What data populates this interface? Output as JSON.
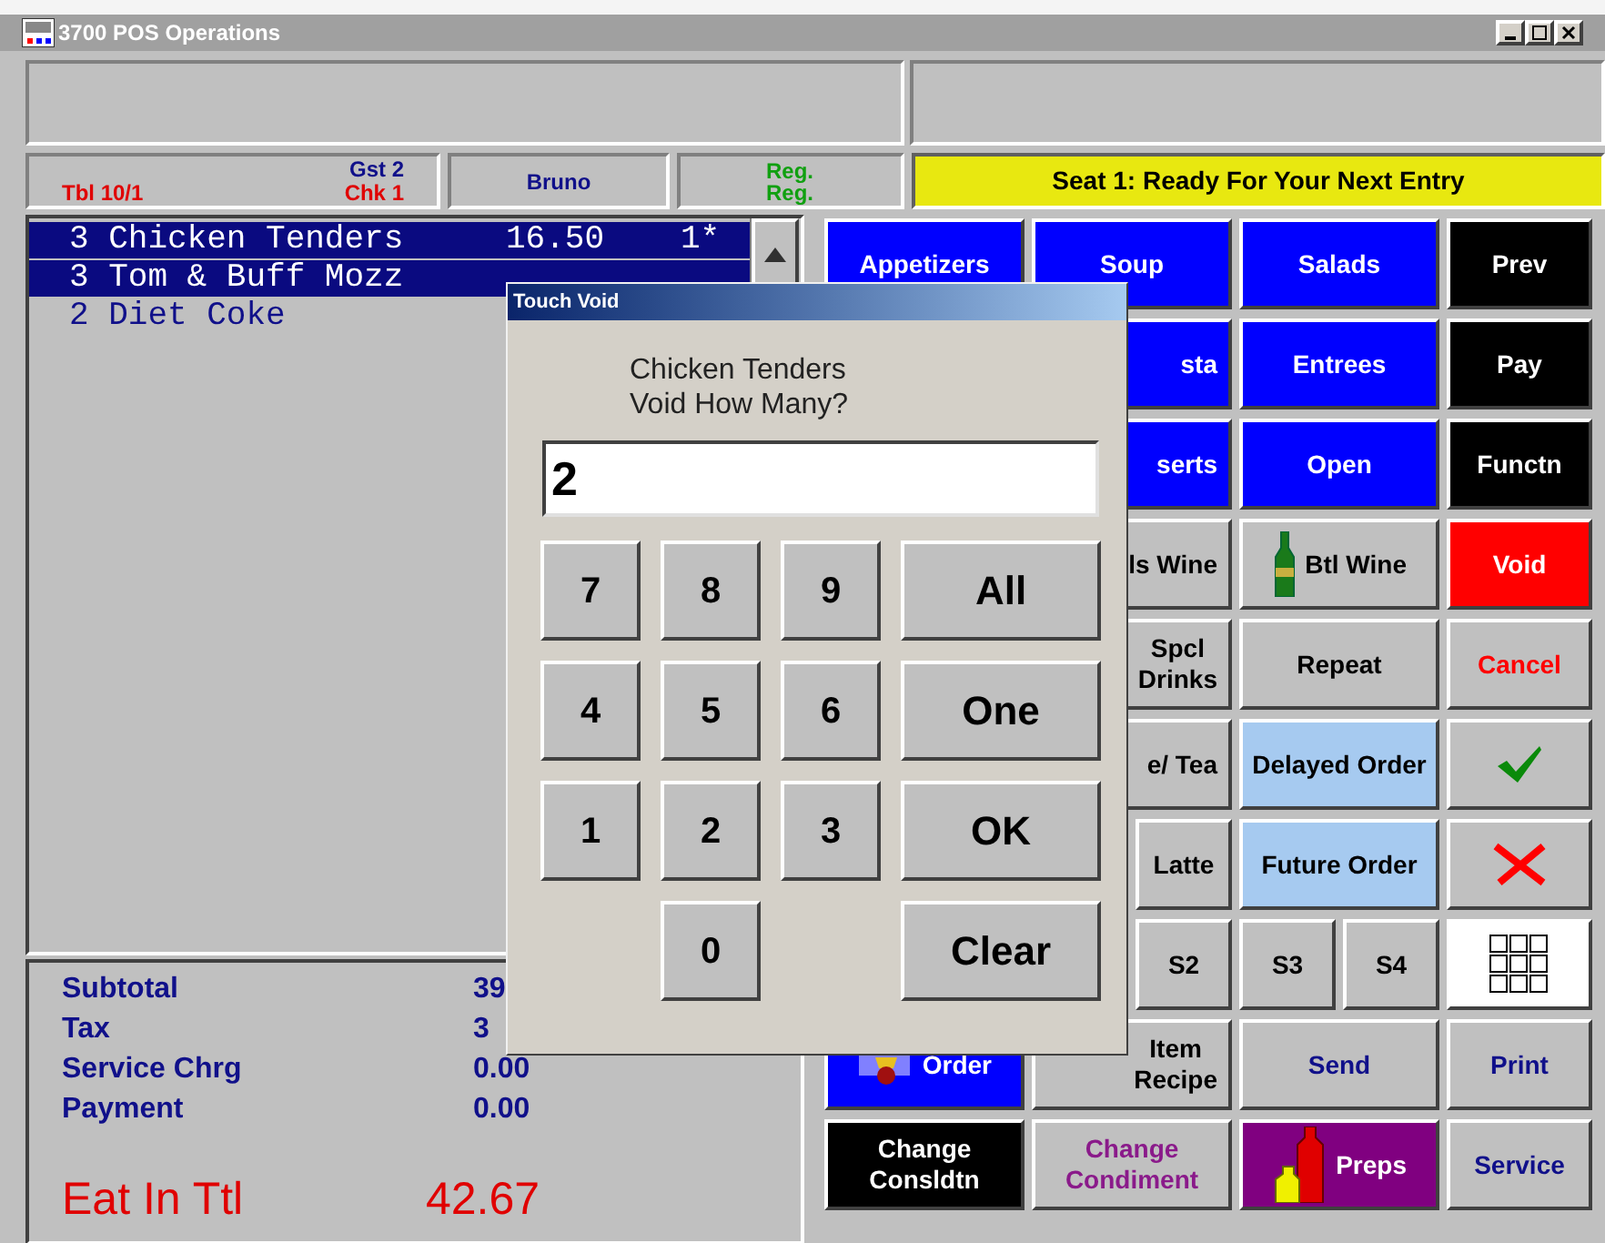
{
  "window": {
    "title": "3700 POS Operations"
  },
  "header": {
    "table": "Tbl 10/1",
    "guests": "Gst 2",
    "check": "Chk 1",
    "employee": "Bruno",
    "modes": [
      "Reg.",
      "Reg."
    ],
    "status": "Seat 1: Ready For Your Next Entry"
  },
  "check_items": [
    {
      "text": "3 Chicken Tenders",
      "price": "16.50",
      "seat": "1*",
      "selected": true
    },
    {
      "text": "3 Tom & Buff Mozz",
      "selected": true
    },
    {
      "text": "2 Diet Coke",
      "selected": false
    }
  ],
  "totals": [
    {
      "label": "Subtotal",
      "value": "39"
    },
    {
      "label": "Tax",
      "value": "3"
    },
    {
      "label": "Service Chrg",
      "value": "0.00"
    },
    {
      "label": "Payment",
      "value": "0.00"
    }
  ],
  "grand_total": {
    "label": "Eat In Ttl",
    "value": "42.67"
  },
  "keys": [
    {
      "kind": "menu",
      "label": "Appetizers"
    },
    {
      "kind": "menu",
      "label": "Soup"
    },
    {
      "kind": "menu",
      "label": "Salads"
    },
    {
      "kind": "command",
      "label": "Prev"
    },
    {
      "kind": "covered"
    },
    {
      "kind": "peekmenu",
      "label": "sta"
    },
    {
      "kind": "menu",
      "label": "Entrees"
    },
    {
      "kind": "command",
      "label": "Pay"
    },
    {
      "kind": "covered"
    },
    {
      "kind": "peekmenu",
      "label": "serts"
    },
    {
      "kind": "menu",
      "label": "Open"
    },
    {
      "kind": "command",
      "label": "Functn"
    },
    {
      "kind": "covered"
    },
    {
      "kind": "peek",
      "label": "ls Wine"
    },
    {
      "kind": "wine",
      "label": "Btl Wine"
    },
    {
      "kind": "alert",
      "label": "Void"
    },
    {
      "kind": "covered"
    },
    {
      "kind": "peek",
      "label": "Spcl\nDrinks"
    },
    {
      "kind": "plain",
      "label": "Repeat"
    },
    {
      "kind": "warning",
      "label": "Cancel"
    },
    {
      "kind": "covered"
    },
    {
      "kind": "peek",
      "label": "e/ Tea"
    },
    {
      "kind": "order",
      "label": "Delayed Order"
    },
    {
      "kind": "confirm"
    },
    {
      "kind": "covered"
    },
    {
      "kind": "split",
      "labels": [
        "Latte"
      ]
    },
    {
      "kind": "order",
      "label": "Future Order"
    },
    {
      "kind": "reject"
    },
    {
      "kind": "covered"
    },
    {
      "kind": "split",
      "labels": [
        "S2"
      ]
    },
    {
      "kind": "split",
      "labels": [
        "S3",
        "S4"
      ]
    },
    {
      "kind": "keypad"
    },
    {
      "kind": "basket",
      "label": "Order"
    },
    {
      "kind": "peek",
      "label": "Item\nRecipe"
    },
    {
      "kind": "action",
      "label": "Send"
    },
    {
      "kind": "action",
      "label": "Print"
    },
    {
      "kind": "command",
      "label": "Change\nConsldtn"
    },
    {
      "kind": "modifier",
      "label": "Change\nCondiment"
    },
    {
      "kind": "prep",
      "label": "Preps"
    },
    {
      "kind": "action",
      "label": "Service"
    }
  ],
  "dialog": {
    "title": "Touch Void",
    "prompt": "Chicken Tenders\nVoid How Many?",
    "value": "2",
    "keys": [
      {
        "label": "7",
        "kind": "digit"
      },
      {
        "label": "8",
        "kind": "digit"
      },
      {
        "label": "9",
        "kind": "digit"
      },
      {
        "label": "All",
        "kind": "action"
      },
      {
        "label": "4",
        "kind": "digit"
      },
      {
        "label": "5",
        "kind": "digit"
      },
      {
        "label": "6",
        "kind": "digit"
      },
      {
        "label": "One",
        "kind": "action"
      },
      {
        "label": "1",
        "kind": "digit"
      },
      {
        "label": "2",
        "kind": "digit"
      },
      {
        "label": "3",
        "kind": "digit"
      },
      {
        "label": "OK",
        "kind": "action"
      },
      {
        "label": "0",
        "kind": "digit"
      },
      {
        "label": "Clear",
        "kind": "action"
      }
    ]
  }
}
